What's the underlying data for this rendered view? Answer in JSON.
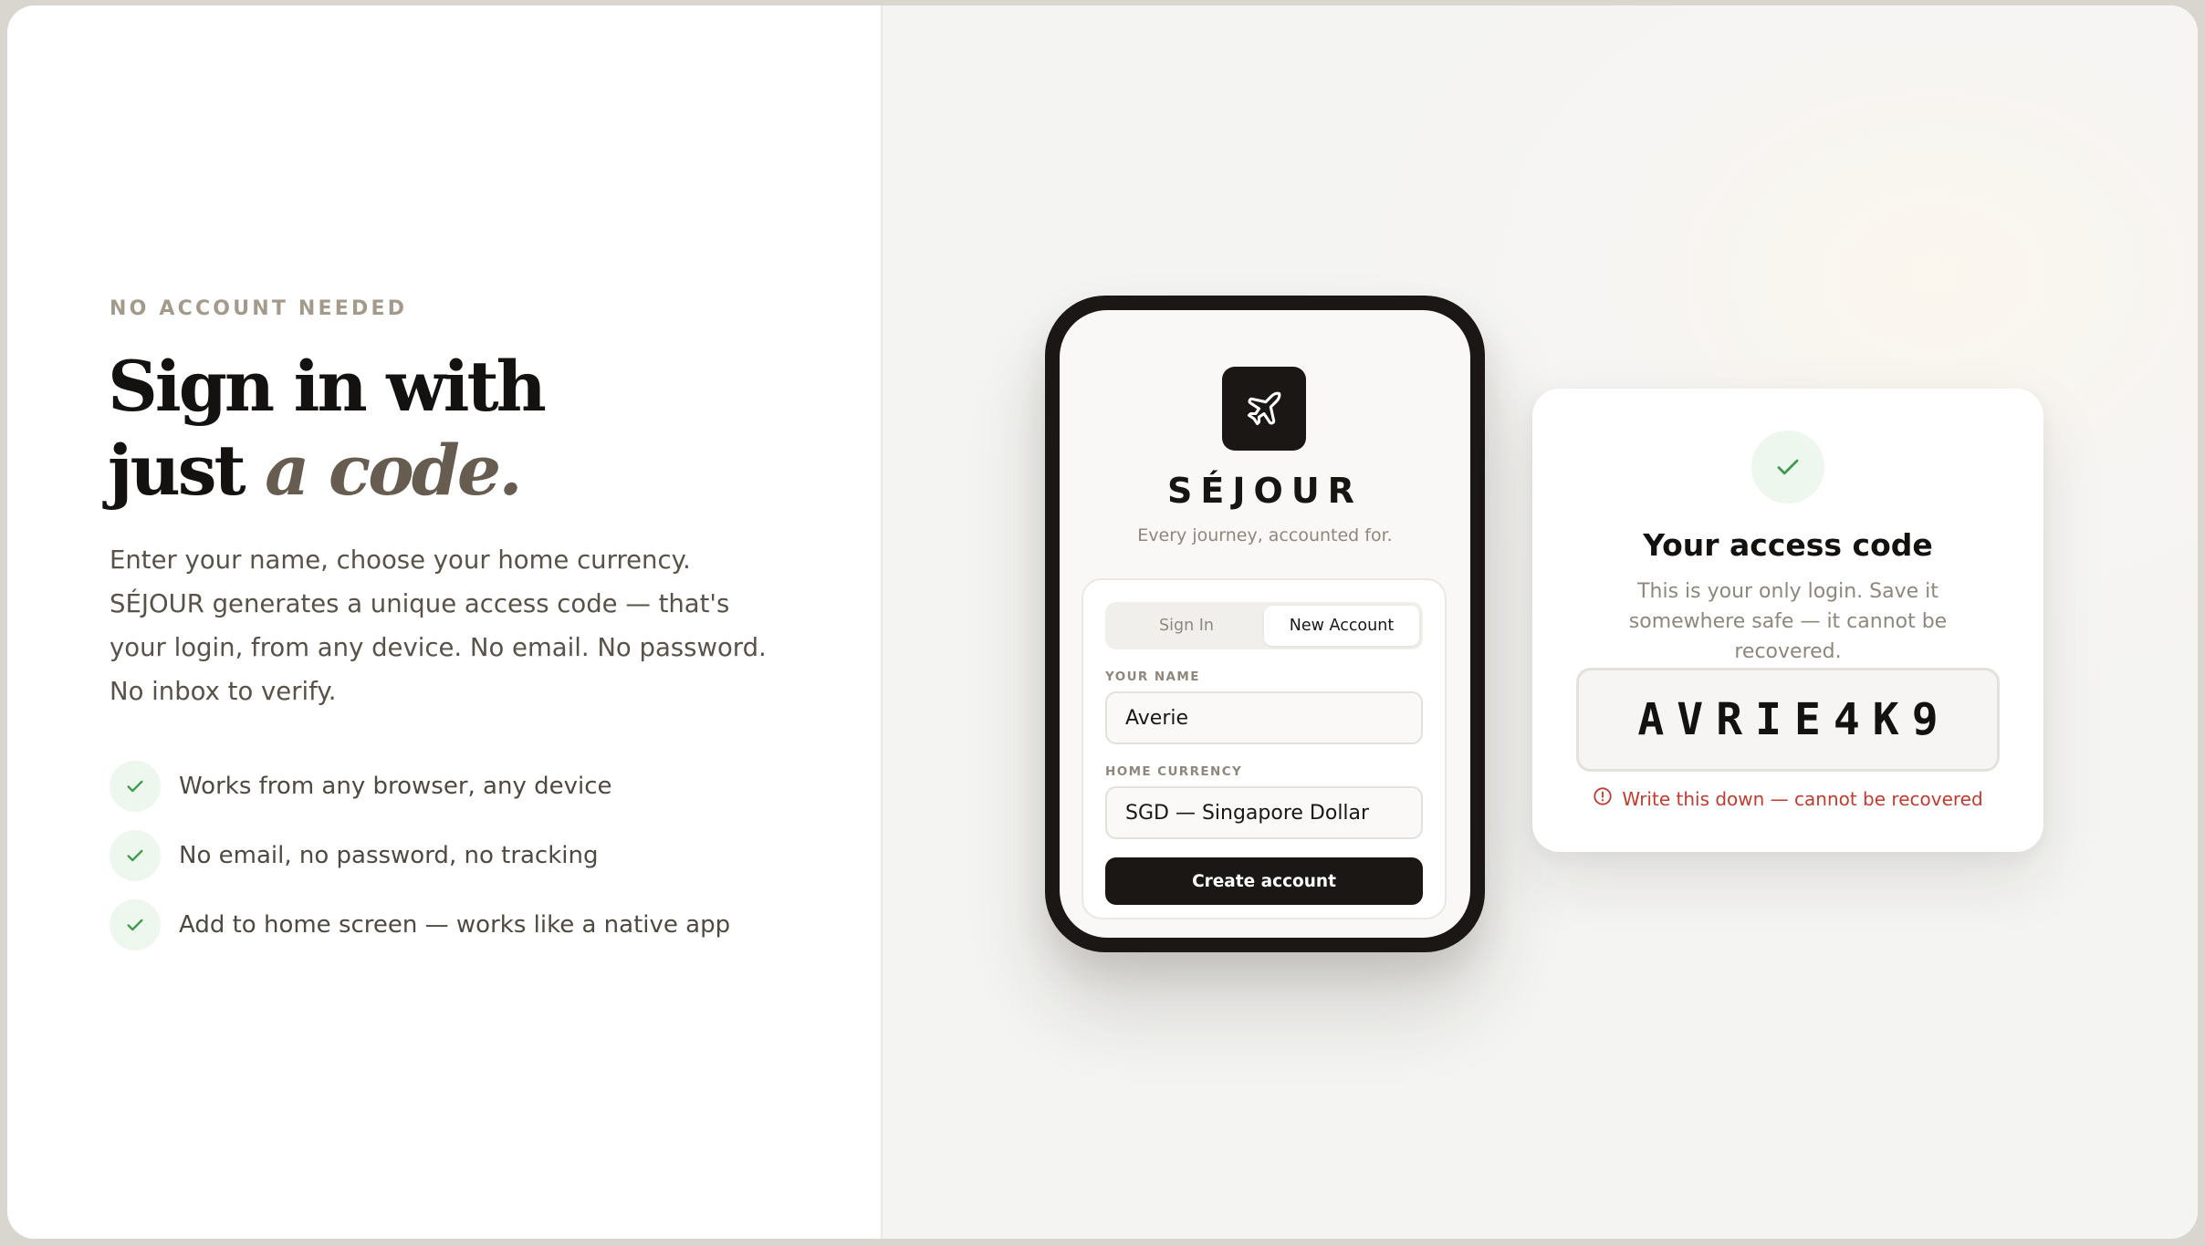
{
  "left": {
    "eyebrow": "NO ACCOUNT NEEDED",
    "headline_line1": "Sign in with",
    "headline_line2_plain": "just ",
    "headline_line2_accent": "a code.",
    "lead": "Enter your name, choose your home currency. SÉJOUR generates a unique access code — that's your login, from any device. No email. No password. No inbox to verify.",
    "features": [
      "Works from any browser, any device",
      "No email, no password, no tracking",
      "Add to home screen — works like a native app"
    ]
  },
  "phone": {
    "icon": "airplane-icon",
    "brand": "SÉJOUR",
    "tagline": "Every journey, accounted for.",
    "tabs": [
      "Sign In",
      "New Account"
    ],
    "active_tab": "New Account",
    "name_label": "YOUR NAME",
    "name_value": "Averie",
    "currency_label": "HOME CURRENCY",
    "currency_value": "SGD — Singapore Dollar",
    "create_label": "Create account"
  },
  "code_card": {
    "icon": "check-icon",
    "title": "Your access code",
    "description": "This is your only login. Save it somewhere safe — it cannot be recovered.",
    "code": "AVRIE4K9",
    "warning_icon": "alert-circle-icon",
    "warning": "Write this down — cannot be recovered"
  },
  "colors": {
    "accent_text": "#675c50",
    "ink": "#1a1714",
    "check_green": "#3d9a4f",
    "check_bg": "#eef7ee",
    "warning_red": "#c43a2f"
  }
}
